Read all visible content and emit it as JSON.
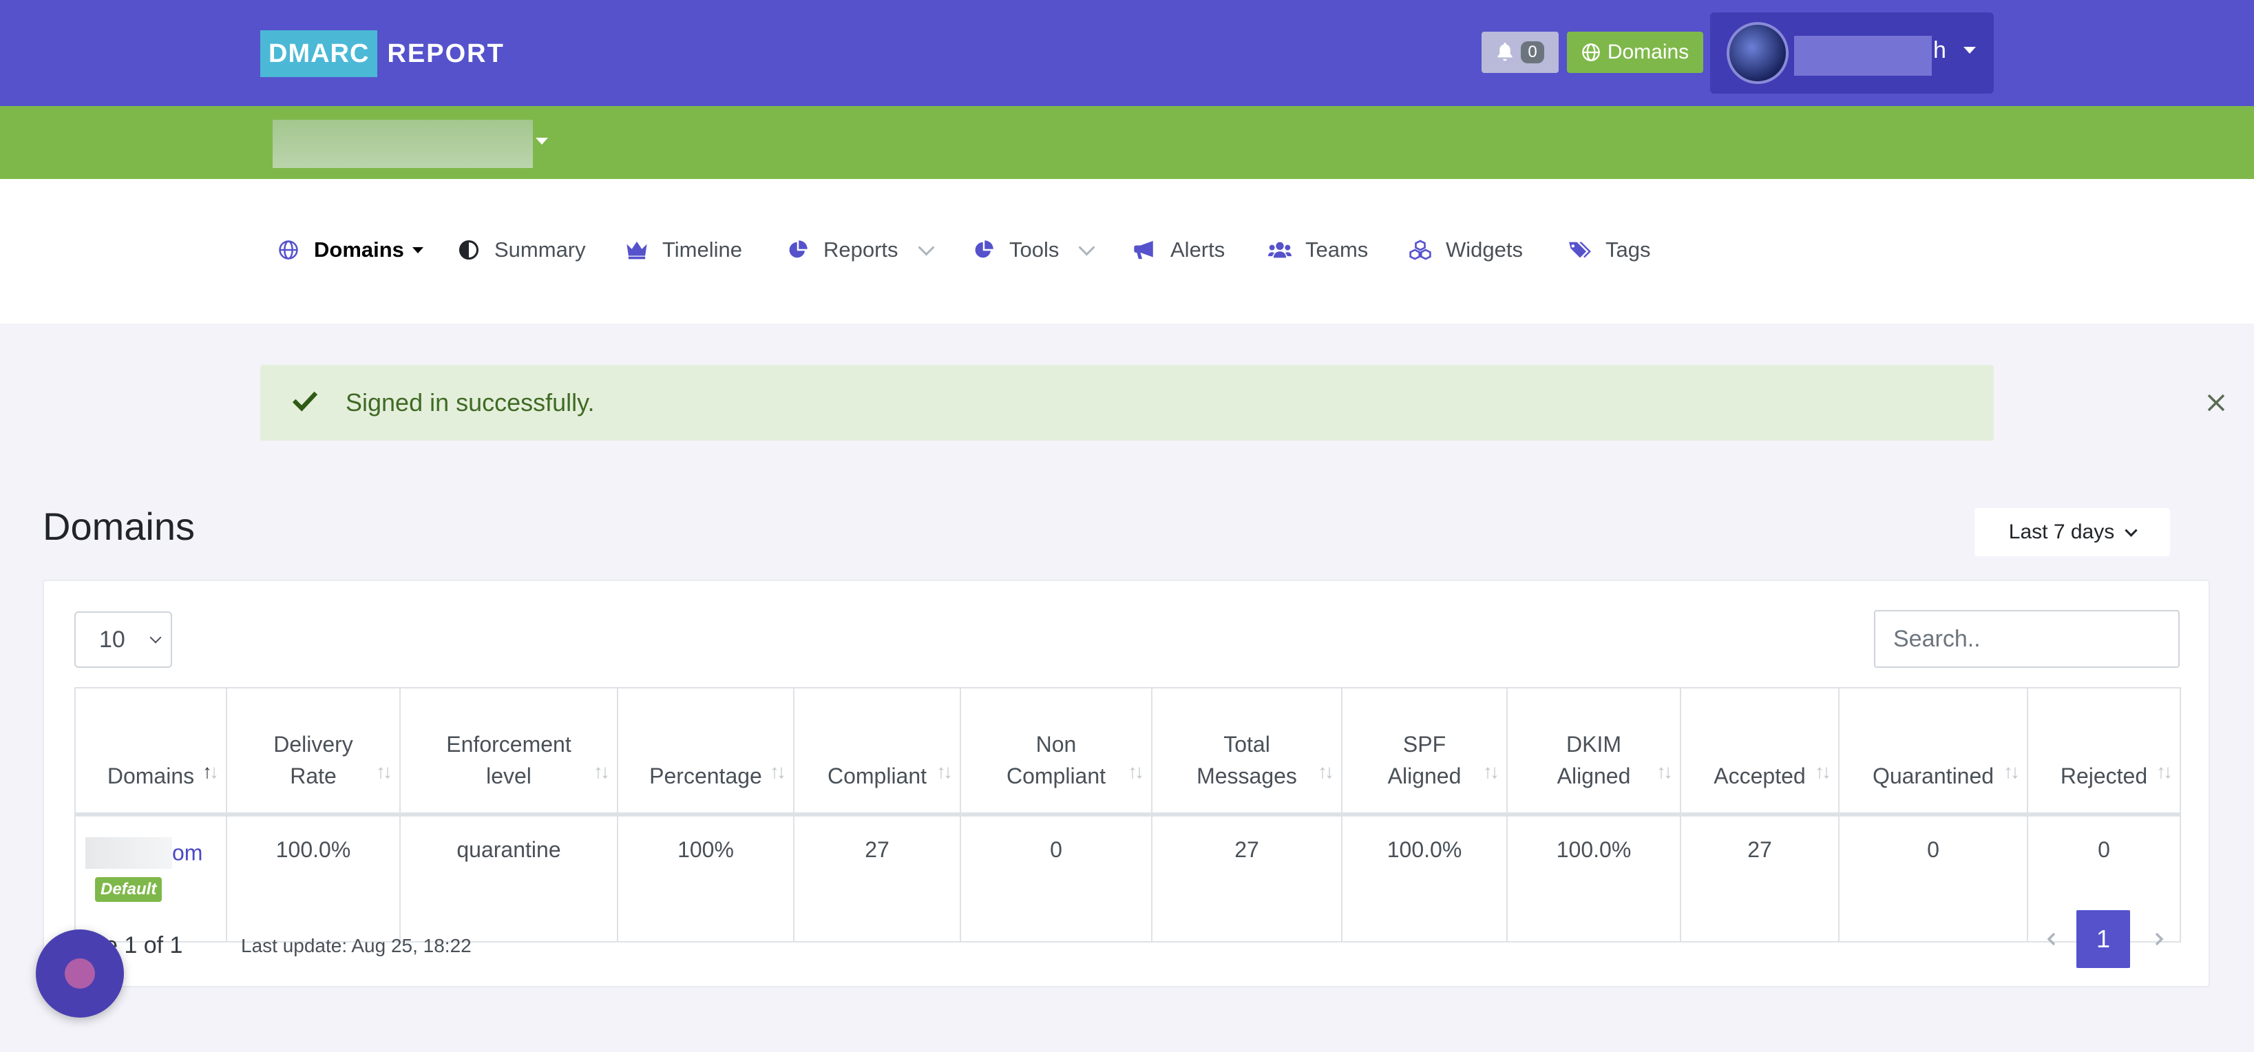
{
  "header": {
    "logo_left": "DMARC",
    "logo_right": "REPORT",
    "notifications_count": "0",
    "domains_button": "Domains",
    "user_name_visible_end": "h",
    "colors": {
      "topbar": "#5552cc",
      "orgbar": "#7fb84a",
      "accent": "#4bb8d6"
    }
  },
  "nav": {
    "items": [
      {
        "label": "Domains",
        "icon": "globe-icon"
      },
      {
        "label": "Summary",
        "icon": "half-circle-icon"
      },
      {
        "label": "Timeline",
        "icon": "crown-icon"
      },
      {
        "label": "Reports",
        "icon": "pie-chart-icon"
      },
      {
        "label": "Tools",
        "icon": "pie-chart-icon"
      },
      {
        "label": "Alerts",
        "icon": "megaphone-icon"
      },
      {
        "label": "Teams",
        "icon": "users-icon"
      },
      {
        "label": "Widgets",
        "icon": "cubes-icon"
      },
      {
        "label": "Tags",
        "icon": "tags-icon"
      }
    ]
  },
  "alert": {
    "message": "Signed in successfully."
  },
  "page": {
    "title": "Domains",
    "range_label": "Last 7 days"
  },
  "controls": {
    "page_size": "10",
    "search_placeholder": "Search.."
  },
  "table": {
    "headers": [
      [
        "Domains"
      ],
      [
        "Delivery",
        "Rate"
      ],
      [
        "Enforcement",
        "level"
      ],
      [
        "Percentage"
      ],
      [
        "Compliant"
      ],
      [
        "Non",
        "Compliant"
      ],
      [
        "Total",
        "Messages"
      ],
      [
        "SPF",
        "Aligned"
      ],
      [
        "DKIM",
        "Aligned"
      ],
      [
        "Accepted"
      ],
      [
        "Quarantined"
      ],
      [
        "Rejected"
      ]
    ],
    "rows": [
      {
        "domain_visible_end": "om",
        "badge": "Default",
        "cells": [
          "100.0%",
          "quarantine",
          "100%",
          "27",
          "0",
          "27",
          "100.0%",
          "100.0%",
          "27",
          "0",
          "0"
        ]
      }
    ]
  },
  "footer": {
    "page_info_visible": "e 1 of 1",
    "last_update": "Last update: Aug 25, 18:22",
    "current_page": "1"
  }
}
